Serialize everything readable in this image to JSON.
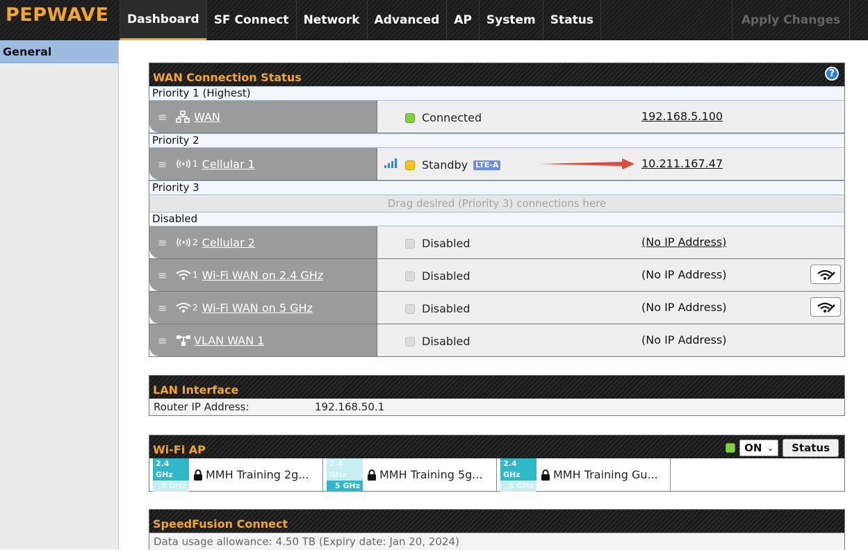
{
  "brand": "PEPWAVE",
  "nav": {
    "tabs": [
      "Dashboard",
      "SF Connect",
      "Network",
      "Advanced",
      "AP",
      "System",
      "Status"
    ],
    "active": "Dashboard",
    "apply": "Apply Changes"
  },
  "sidebar": {
    "items": [
      "General"
    ]
  },
  "wan": {
    "title": "WAN Connection Status",
    "help": "?",
    "priority1": "Priority 1 (Highest)",
    "priority2": "Priority 2",
    "priority3": "Priority 3",
    "disabled": "Disabled",
    "drag_hint": "Drag desired (Priority 3) connections here",
    "rows": [
      {
        "name": "WAN",
        "sub": "",
        "icon": "ethernet-icon",
        "status": "Connected",
        "status_color": "#7fd23a",
        "ip": "192.168.5.100"
      },
      {
        "name": "Cellular 1",
        "sub": "1",
        "icon": "cellular-icon",
        "status": "Standby",
        "status_color": "#f5c518",
        "badge": "LTE-A",
        "ip": "10.211.167.47"
      },
      {
        "name": "Cellular 2",
        "sub": "2",
        "icon": "cellular-icon",
        "status": "Disabled",
        "ip": "(No IP Address)"
      },
      {
        "name": "Wi-Fi WAN on 2.4 GHz",
        "sub": "1",
        "icon": "wifi-icon",
        "status": "Disabled",
        "ip": "(No IP Address)"
      },
      {
        "name": "Wi-Fi WAN on 5 GHz",
        "sub": "2",
        "icon": "wifi-icon",
        "status": "Disabled",
        "ip": "(No IP Address)"
      },
      {
        "name": "VLAN WAN 1",
        "sub": "",
        "icon": "vlan-icon",
        "status": "Disabled",
        "ip": "(No IP Address)"
      }
    ]
  },
  "lan": {
    "title": "LAN Interface",
    "label": "Router IP Address:",
    "value": "192.168.50.1"
  },
  "wifi_ap": {
    "title": "Wi-Fi AP",
    "state": "ON",
    "status_button": "Status",
    "band24": "2.4 GHz",
    "band5": "5 GHz",
    "ssids": [
      {
        "name": "MMH Training 2g...",
        "active_band": "2.4"
      },
      {
        "name": "MMH Training 5g...",
        "active_band": "5"
      },
      {
        "name": "MMH Training Gu...",
        "active_band": "2.4"
      }
    ]
  },
  "speedfusion": {
    "title": "SpeedFusion Connect",
    "usage": "Data usage allowance: 4.50 TB (Expiry date: Jan 20, 2024)"
  },
  "colors": {
    "accent": "#f5a623",
    "connected": "#7fd23a",
    "standby": "#f5c518",
    "sidebar_active": "#9dbbe0",
    "band": "#2fb8c8",
    "lte_badge": "#6a8de8",
    "arrow": "#e04a3a"
  }
}
